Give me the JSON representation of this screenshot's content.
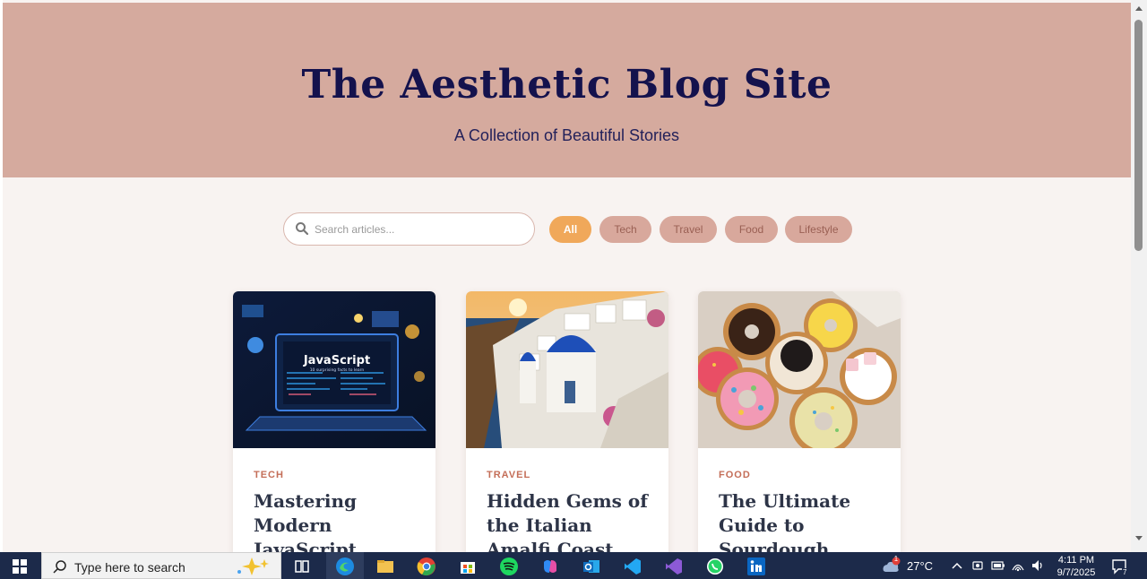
{
  "site": {
    "title": "The Aesthetic Blog Site",
    "subtitle": "A Collection of Beautiful Stories"
  },
  "search": {
    "placeholder": "Search articles..."
  },
  "filters": [
    {
      "label": "All",
      "active": true
    },
    {
      "label": "Tech",
      "active": false
    },
    {
      "label": "Travel",
      "active": false
    },
    {
      "label": "Food",
      "active": false
    },
    {
      "label": "Lifestyle",
      "active": false
    }
  ],
  "articles": [
    {
      "category": "TECH",
      "title": "Mastering Modern JavaScript",
      "image_text": "JavaScript",
      "image_subtext": "10 surprising facts to learn"
    },
    {
      "category": "TRAVEL",
      "title": "Hidden Gems of the Italian Amalfi Coast"
    },
    {
      "category": "FOOD",
      "title": "The Ultimate Guide to Sourdough Baking"
    }
  ],
  "taskbar": {
    "search_placeholder": "Type here to search",
    "weather": "27°C",
    "time": "4:11 PM",
    "date": "9/7/2025",
    "notification_count": "7",
    "weather_badge": "1",
    "apps": [
      "task-view",
      "edge",
      "file-explorer",
      "chrome",
      "microsoft-store",
      "spotify",
      "copilot",
      "outlook",
      "vscode",
      "visual-studio",
      "whatsapp",
      "linkedin"
    ]
  },
  "colors": {
    "hero_bg": "#d5aa9e",
    "title_color": "#14124d",
    "chip_active": "#f0a85a",
    "chip": "#d8a89c",
    "category": "#c46e58",
    "page_bg": "#f8f3f1"
  }
}
